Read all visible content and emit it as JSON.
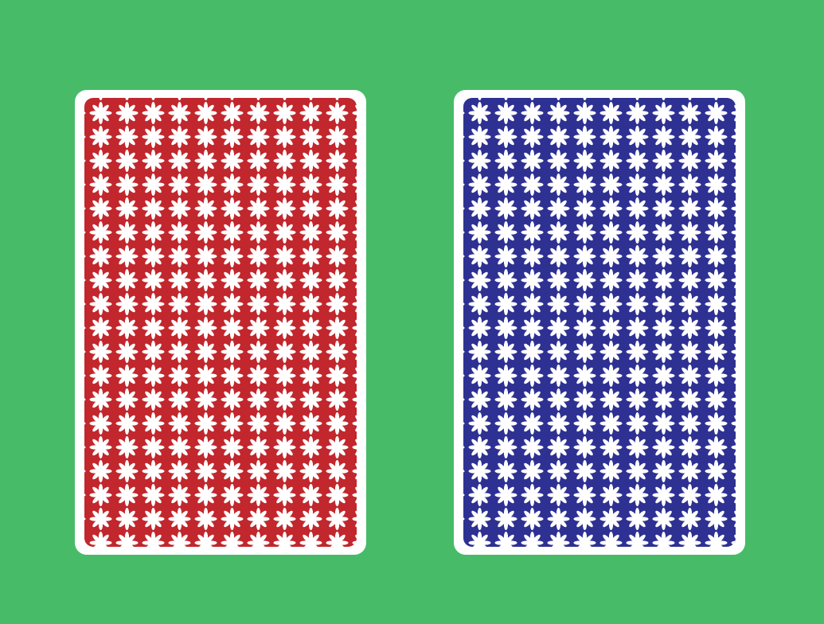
{
  "scene": {
    "background_color": "#48bb68",
    "card_border_color": "#ffffff",
    "motif_color": "#ffffff",
    "motif_icon": "eight-petal-flower-icon"
  },
  "cards": [
    {
      "id": "card-back-red",
      "color": "#c1272d",
      "face": "back"
    },
    {
      "id": "card-back-blue",
      "color": "#2e3192",
      "face": "back"
    }
  ]
}
